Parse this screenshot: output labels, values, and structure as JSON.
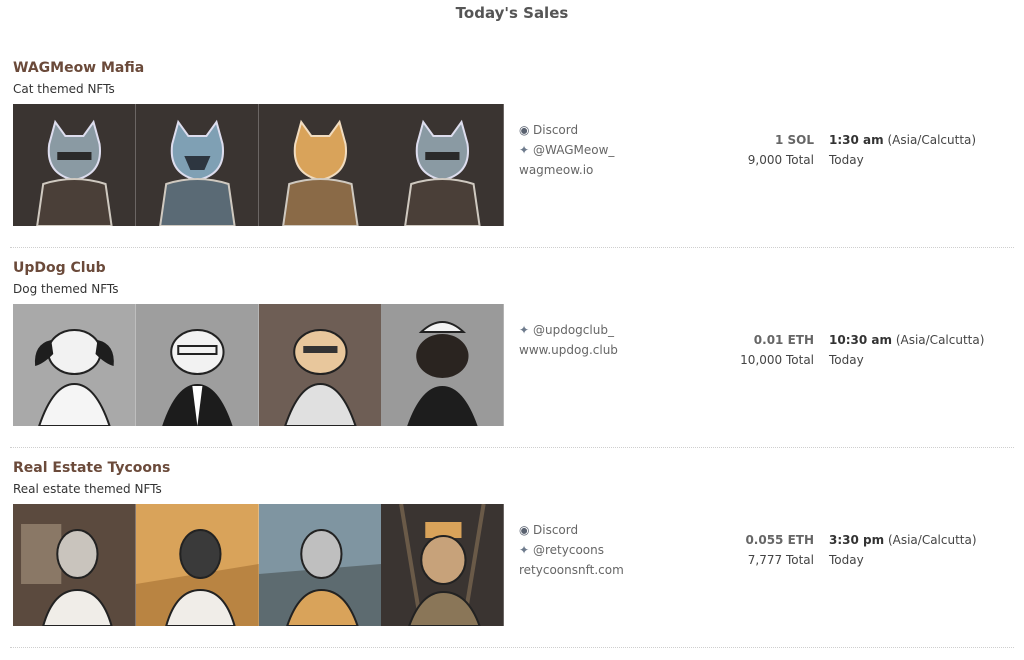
{
  "page": {
    "title": "Today's Sales"
  },
  "projects": [
    {
      "name": "WAGMeow Mafia",
      "description": "Cat themed NFTs",
      "links": {
        "discord": "Discord",
        "twitter": "@WAGMeow_",
        "website": "wagmeow.io"
      },
      "price": "1 SOL",
      "supply": "9,000 Total",
      "time": "1:30 am",
      "timezone": "(Asia/Calcutta)",
      "day": "Today"
    },
    {
      "name": "UpDog Club",
      "description": "Dog themed NFTs",
      "links": {
        "twitter": "@updogclub_",
        "website": "www.updog.club"
      },
      "price": "0.01 ETH",
      "supply": "10,000 Total",
      "time": "10:30 am",
      "timezone": "(Asia/Calcutta)",
      "day": "Today"
    },
    {
      "name": "Real Estate Tycoons",
      "description": "Real estate themed NFTs",
      "links": {
        "discord": "Discord",
        "twitter": "@retycoons",
        "website": "retycoonsnft.com"
      },
      "price": "0.055 ETH",
      "supply": "7,777 Total",
      "time": "3:30 pm",
      "timezone": "(Asia/Calcutta)",
      "day": "Today"
    }
  ],
  "icons": {
    "discord": "discord-icon",
    "twitter": "twitter-bird-icon"
  },
  "colors": {
    "project_name": "#6b4a3a",
    "cat_background": "#3a3431",
    "dog_background": "#8b8b8b",
    "tycoon_gold": "#d9a35a"
  }
}
